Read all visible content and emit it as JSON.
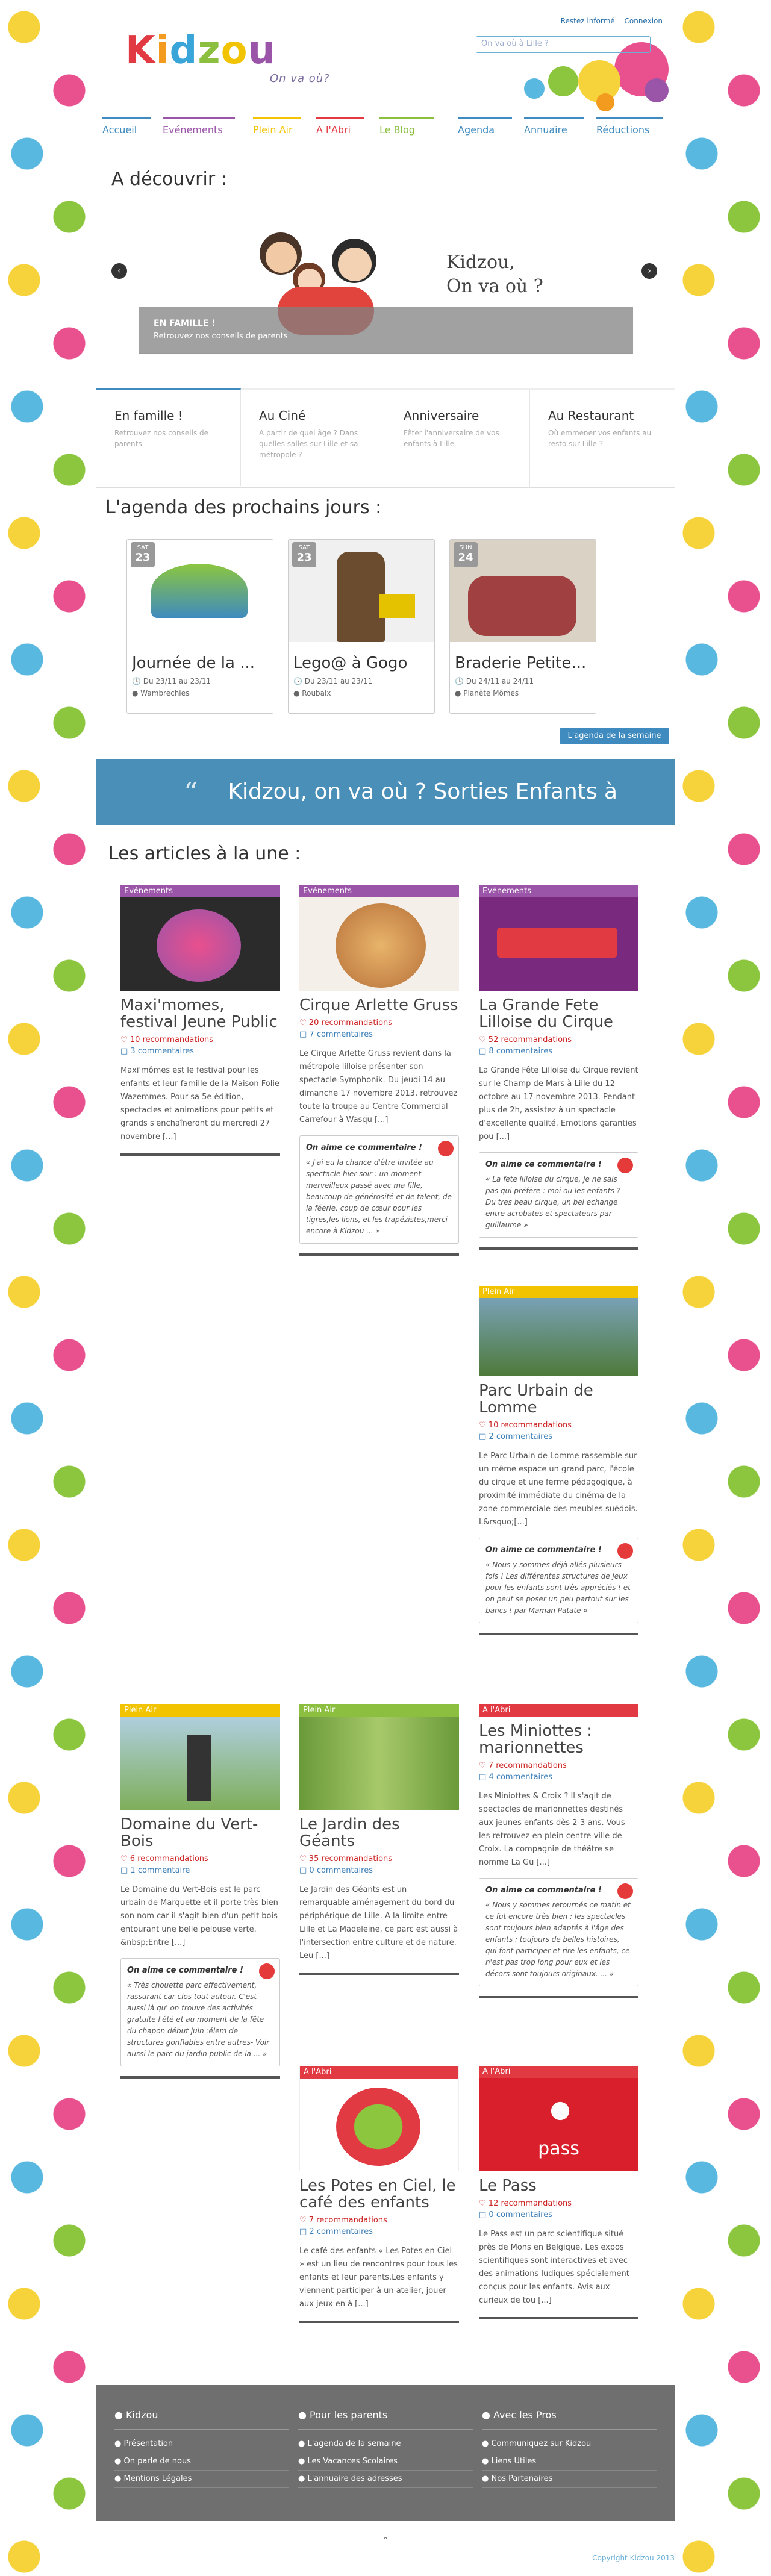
{
  "header": {
    "logo": [
      "K",
      "i",
      "d",
      "z",
      "o",
      "u"
    ],
    "logo_colors": [
      "#e23a43",
      "#f29b1e",
      "#3aa5d8",
      "#8cbf3f",
      "#f2c300",
      "#9a54a8"
    ],
    "tagline": "On va où?",
    "top_links": [
      "Restez informé",
      "Connexion"
    ],
    "search_placeholder": "On va où à Lille ?"
  },
  "nav": [
    {
      "label": "Accueil",
      "color": "#3f8bbf"
    },
    {
      "label": "Evénements",
      "color": "#9a54a8"
    },
    {
      "label": "Plein Air",
      "color": "#f2c300"
    },
    {
      "label": "A l'Abri",
      "color": "#e23a43"
    },
    {
      "label": "Le Blog",
      "color": "#8cbf3f"
    },
    {
      "label": "Agenda",
      "color": "#3f8bbf"
    },
    {
      "label": "Annuaire",
      "color": "#3f8bbf"
    },
    {
      "label": "Réductions",
      "color": "#3f8bbf"
    }
  ],
  "discover": {
    "title": "A découvrir :",
    "slide_brand_1": "Kidzou,",
    "slide_brand_2": "On va où ?",
    "slide_caption_title": "EN FAMILLE !",
    "slide_caption_text": "Retrouvez nos conseils de parents"
  },
  "tiles": [
    {
      "title": "En famille !",
      "desc": "Retrouvez nos conseils de parents"
    },
    {
      "title": "Au Ciné",
      "desc": "A partir de quel âge ? Dans quelles salles sur Lille et sa métropole ?"
    },
    {
      "title": "Anniversaire",
      "desc": "Fêter l'anniversaire de vos enfants à Lille"
    },
    {
      "title": "Au Restaurant",
      "desc": "Où emmener vos enfants au resto sur Lille ?"
    }
  ],
  "agenda": {
    "title": "L'agenda des prochains jours :",
    "cards": [
      {
        "month": "SAT",
        "day": "23",
        "title": "Journée de la ...",
        "date": "Du 23/11 au 23/11",
        "place": "Wambrechies"
      },
      {
        "month": "SAT",
        "day": "23",
        "title": "Lego@ à Gogo",
        "date": "Du 23/11 au 23/11",
        "place": "Roubaix"
      },
      {
        "month": "SUN",
        "day": "24",
        "title": "Braderie Petite...",
        "date": "Du 24/11 au 24/11",
        "place": "Planète Mômes"
      }
    ],
    "button": "L'agenda de la semaine"
  },
  "banner": "Kidzou, on va où ? Sorties Enfants à Lille",
  "featured": {
    "title": "Les articles à la une :",
    "quote_label": "On aime ce commentaire !",
    "articles": [
      {
        "cat": "Evénements",
        "catcolor": "#9a54a8",
        "title": "Maxi'momes, festival Jeune Public",
        "recos": "10  recommandations",
        "comments": "3 commentaires",
        "text": "Maxi'mômes est le festival pour les enfants et leur famille de la Maison Folie Wazemmes. Pour sa 5e édition, spectacles et animations pour petits et grands s'enchaîneront du mercredi 27 novembre [...]",
        "quote": ""
      },
      {
        "cat": "Evénements",
        "catcolor": "#9a54a8",
        "title": "Cirque Arlette Gruss",
        "recos": "20  recommandations",
        "comments": "7 commentaires",
        "text": "Le Cirque Arlette Gruss revient dans la métropole lilloise présenter son spectacle Symphonik. Du jeudi 14 au dimanche 17 novembre 2013, retrouvez toute la troupe au Centre Commercial Carrefour à Wasqu [...]",
        "quote": "« J'ai eu la chance d'être invitée au spectacle hier soir : un moment merveilleux passé avec ma fille, beaucoup de générosité et de talent, de la féerie, coup de cœur pour les tigres,les lions, et les trapézistes,merci encore à Kidzou ... »"
      },
      {
        "cat": "Evénements",
        "catcolor": "#9a54a8",
        "title": "La Grande Fete Lilloise du Cirque",
        "recos": "52  recommandations",
        "comments": "8 commentaires",
        "text": "La Grande Fête Lilloise du Cirque revient sur le Champ de Mars à Lille du 12 octobre au 17 novembre 2013. Pendant plus de 2h, assistez à un spectacle d'excellente qualité. Emotions garanties pou [...]",
        "quote": "« La fete lilloise du cirque, je ne sais pas qui préfère : moi ou les enfants ? Du tres beau cirque, un bel echange entre acrobates et spectateurs par guillaume »"
      },
      {
        "cat": "Plein Air",
        "catcolor": "#f2c300",
        "title": "Parc Urbain de Lomme",
        "recos": "10  recommandations",
        "comments": "2 commentaires",
        "text": "Le Parc Urbain de Lomme rassemble sur un même espace un grand parc, l'école du cirque et une ferme pédagogique, à proximité immédiate du cinéma de la zone commerciale des meubles suédois. L&rsquo;[...]",
        "quote": "« Nous y sommes déjà allés plusieurs fois ! Les différentes structures de jeux pour les enfants sont très appréciés ! et on peut se poser un peu partout sur les bancs ! par Maman Patate »"
      },
      {
        "cat": "Plein Air",
        "catcolor": "#f2c300",
        "title": "Domaine du Vert-Bois",
        "recos": "6  recommandations",
        "comments": "1 commentaire",
        "text": "Le Domaine du Vert-Bois est le parc urbain de Marquette et il porte très bien son nom car il s'agit bien d'un petit bois entourant une belle pelouse verte.        &nbsp;Entre [...]",
        "quote": "« Très chouette parc effectivement, rassurant car clos tout autour. C'est aussi là qu' on trouve des activités gratuite l'été et au moment de la fête du chapon début juin :élem de structures gonflables entre autres- Voir aussi le parc du jardin public de la ... »"
      },
      {
        "cat": "Plein Air",
        "catcolor": "#8cbf3f",
        "title": "Le Jardin des Géants",
        "recos": "35  recommandations",
        "comments": "0 commentaires",
        "text": "Le Jardin des Géants est un remarquable aménagement du bord du périphérique de Lille. A la limite entre Lille et La Madeleine, ce parc est aussi à l'intersection entre culture et de nature. Leu [...]",
        "quote": ""
      },
      {
        "cat": "A l'Abri",
        "catcolor": "#e23a43",
        "title": "Les Miniottes : marionnettes",
        "recos": "7  recommandations",
        "comments": "4 commentaires",
        "text": "Les Miniottes & Croix ? Il s'agit de spectacles de marionnettes destinés aux jeunes enfants dès 2-3 ans. Vous les retrouvez en plein centre-ville de Croix. La compagnie de théâtre se nomme La Gu [...]",
        "quote": "« Nous y sommes retournés ce matin et ce fut encore très bien : les spectacles sont toujours bien adaptés à l'âge des enfants : toujours de belles histoires, qui font participer et rire les enfants, ce n'est pas trop long pour eux et les décors sont toujours originaux. ... »"
      },
      {
        "cat": "A l'Abri",
        "catcolor": "#e23a43",
        "title": "Les Potes en Ciel, le café des enfants",
        "recos": "7  recommandations",
        "comments": "2 commentaires",
        "text": "Le café des enfants « Les Potes en Ciel » est un lieu de rencontres pour tous les enfants et leur parents.Les enfants y viennent participer à un atelier, jouer aux jeux en à [...]",
        "quote": ""
      },
      {
        "cat": "A l'Abri",
        "catcolor": "#e23a43",
        "title": "Le Pass",
        "recos": "12  recommandations",
        "comments": "0 commentaires",
        "text": "Le Pass est un parc scientifique situé près de Mons en Belgique. Les expos scientifiques sont interactives et avec des animations ludiques spécialement conçus pour les enfants. Avis aux curieux de tou [...]",
        "quote": ""
      }
    ]
  },
  "footer": {
    "cols": [
      {
        "title": "Kidzou",
        "links": [
          "Présentation",
          "On parle de nous",
          "Mentions Légales"
        ]
      },
      {
        "title": "Pour les parents",
        "links": [
          "L'agenda de la semaine",
          "Les Vacances Scolaires",
          "L'annuaire des adresses"
        ]
      },
      {
        "title": "Avec les Pros",
        "links": [
          "Communiquez sur Kidzou",
          "Liens Utiles",
          "Nos Partenaires"
        ]
      }
    ],
    "copyright": "Copyright Kidzou 2013"
  }
}
